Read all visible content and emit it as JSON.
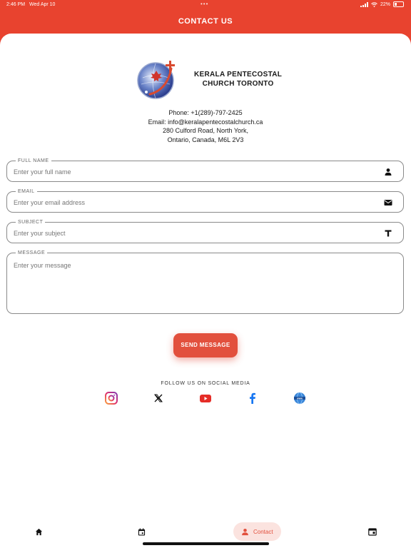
{
  "status_bar": {
    "time": "2:46 PM",
    "date": "Wed Apr 10",
    "battery": "22%"
  },
  "header": {
    "title": "CONTACT US"
  },
  "church": {
    "name_line1": "KERALA PENTECOSTAL",
    "name_line2": "CHURCH TORONTO"
  },
  "contact": {
    "phone": "Phone:  +1(289)-797-2425",
    "email": "Email:  info@keralapentecostalchurch.ca",
    "address_line1": "280 Culford Road, North York,",
    "address_line2": "Ontario, Canada, M6L 2V3"
  },
  "form": {
    "full_name": {
      "label": "FULL NAME",
      "placeholder": "Enter your full name",
      "icon": "person-icon"
    },
    "email": {
      "label": "EMAIL",
      "placeholder": "Enter your email address",
      "icon": "mail-icon"
    },
    "subject": {
      "label": "SUBJECT",
      "placeholder": "Enter your subject",
      "icon": "text-icon"
    },
    "message": {
      "label": "MESSAGE",
      "placeholder": "Enter your message"
    },
    "send_label": "SEND MESSAGE"
  },
  "social": {
    "label": "FOLLOW US ON SOCIAL MEDIA",
    "icons": [
      "instagram-icon",
      "x-icon",
      "youtube-icon",
      "facebook-icon",
      "website-icon"
    ]
  },
  "bottom_nav": {
    "active_label": "Contact",
    "items": [
      "home-icon",
      "calendar-icon",
      "contact-icon",
      "window-icon"
    ]
  },
  "colors": {
    "accent": "#e8432f",
    "button": "#e2503d",
    "active_nav_bg": "#fbe3df"
  }
}
